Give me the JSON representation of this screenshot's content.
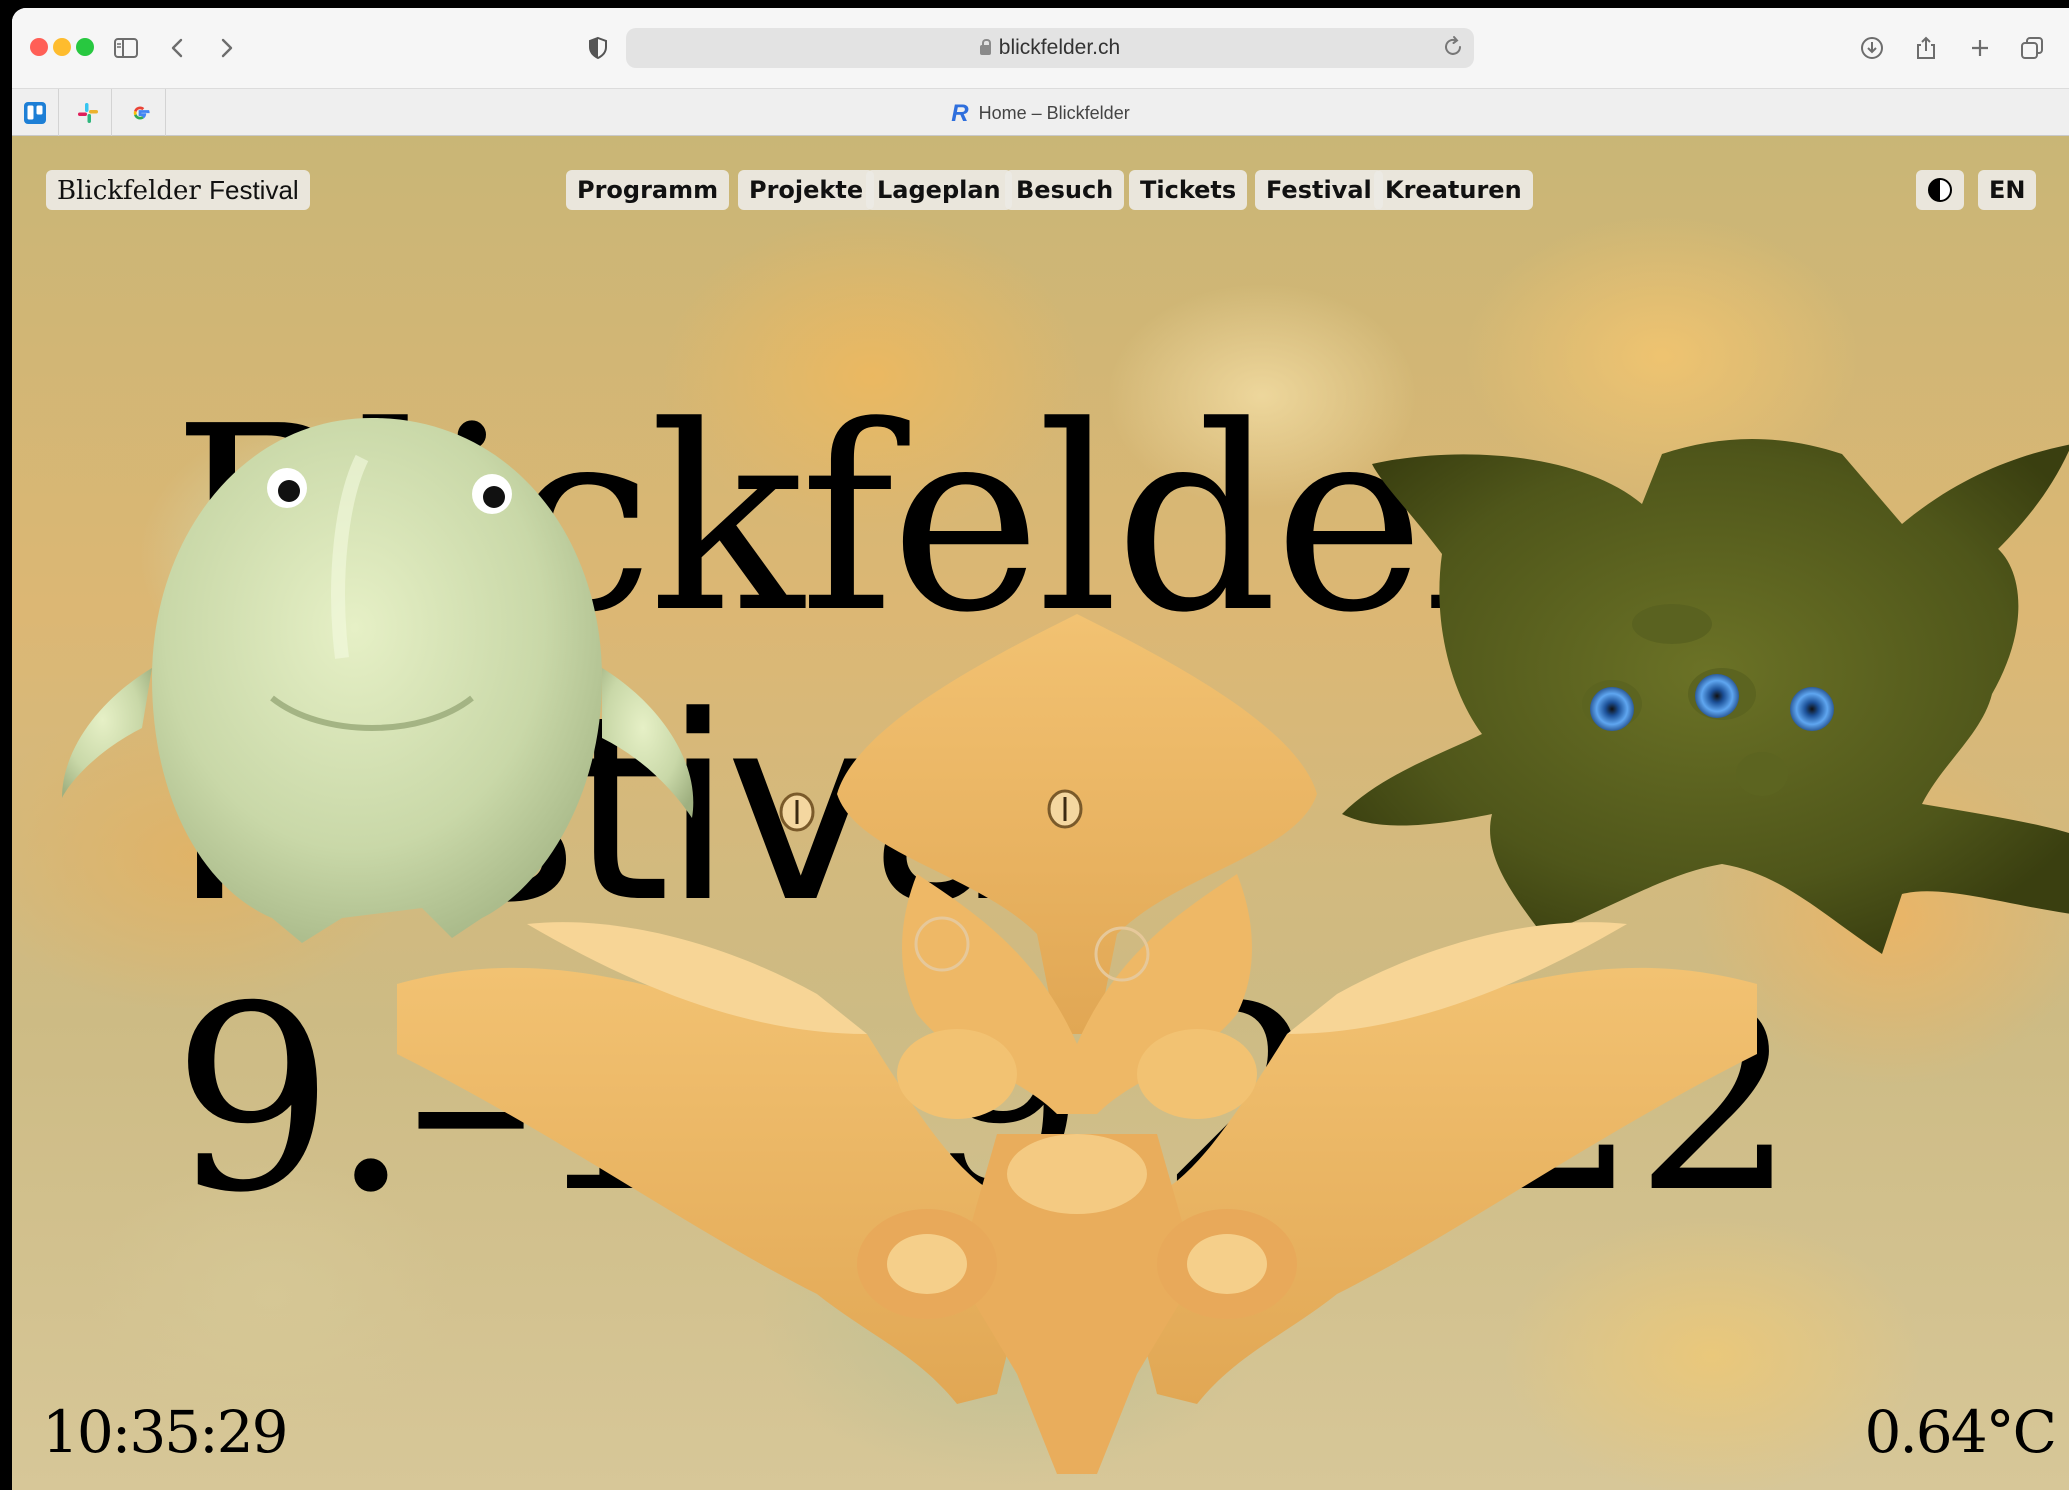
{
  "browser": {
    "url": "blickfelder.ch",
    "tab_title": "Home – Blickfelder",
    "tab_icon_letter": "R",
    "traffic_lights": {
      "close": "#ff5f57",
      "minimize": "#febc2e",
      "zoom": "#28c840"
    },
    "toolbar_icons": [
      "sidebar-icon",
      "back-icon",
      "forward-icon",
      "shield-icon",
      "reload-icon",
      "download-icon",
      "share-icon",
      "new-tab-icon",
      "tabs-overview-icon"
    ],
    "favorites": [
      "trello-icon",
      "slack-icon",
      "google-icon"
    ]
  },
  "site": {
    "brand_name": "Blickfelder",
    "brand_suffix": "Festival",
    "nav": [
      "Programm",
      "Projekte",
      "Lageplan",
      "Besuch",
      "Tickets",
      "Festival",
      "Kreaturen"
    ],
    "language": "EN",
    "hero_line1": "Blickfelder",
    "hero_line2": "Festival",
    "hero_line3": "9.–18.9.2022",
    "clock": "10:35:29",
    "temperature": "0.64°C"
  }
}
